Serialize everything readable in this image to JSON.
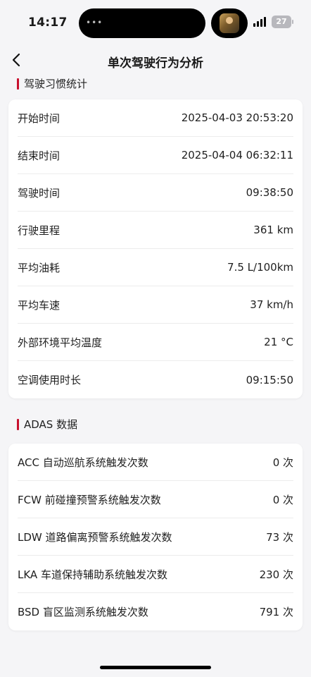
{
  "status_bar": {
    "time": "14:17",
    "battery": "27"
  },
  "nav": {
    "title": "单次驾驶行为分析"
  },
  "sections": [
    {
      "title": "驾驶习惯统计",
      "rows": [
        {
          "label": "开始时间",
          "value": "2025-04-03 20:53:20"
        },
        {
          "label": "结束时间",
          "value": "2025-04-04 06:32:11"
        },
        {
          "label": "驾驶时间",
          "value": "09:38:50"
        },
        {
          "label": "行驶里程",
          "value": "361 km"
        },
        {
          "label": "平均油耗",
          "value": "7.5 L/100km"
        },
        {
          "label": "平均车速",
          "value": "37 km/h"
        },
        {
          "label": "外部环境平均温度",
          "value": "21 °C"
        },
        {
          "label": "空调使用时长",
          "value": "09:15:50"
        }
      ]
    },
    {
      "title": "ADAS 数据",
      "rows": [
        {
          "label": "ACC 自动巡航系统触发次数",
          "value": "0 次"
        },
        {
          "label": "FCW 前碰撞预警系统触发次数",
          "value": "0 次"
        },
        {
          "label": "LDW 道路偏离预警系统触发次数",
          "value": "73 次"
        },
        {
          "label": "LKA 车道保持辅助系统触发次数",
          "value": "230 次"
        },
        {
          "label": "BSD 盲区监测系统触发次数",
          "value": "791 次"
        }
      ]
    }
  ],
  "colors": {
    "accent": "#c8102e",
    "background": "#f5f5f7",
    "card": "#ffffff"
  },
  "icons": {
    "back": "chevron-left-icon"
  }
}
